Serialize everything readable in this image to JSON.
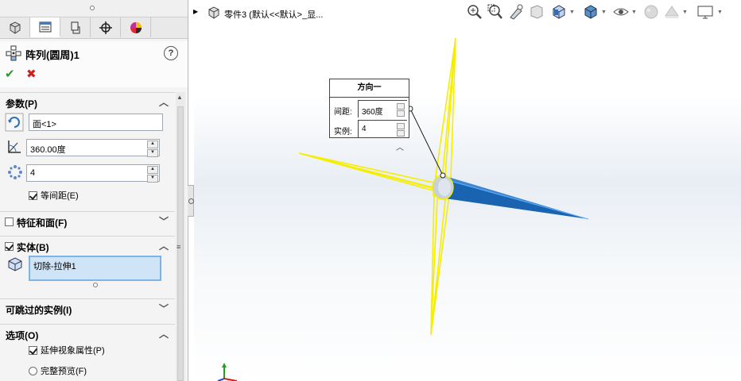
{
  "property_manager": {
    "feature_title": "阵列(圆周)1",
    "help_label": "?",
    "ok_glyph": "✔",
    "cancel_glyph": "✖",
    "tabs": [
      {
        "icon": "feature-manager-icon"
      },
      {
        "icon": "property-manager-icon"
      },
      {
        "icon": "configuration-manager-icon"
      },
      {
        "icon": "dimxpert-manager-icon"
      },
      {
        "icon": "display-manager-icon"
      }
    ],
    "parameters": {
      "header": "参数(P)",
      "axis_value": "面<1>",
      "angle_value": "360.00度",
      "instances_value": "4",
      "equal_spacing_label": "等间距(E)",
      "equal_spacing_checked": true
    },
    "features_faces": {
      "header": "特征和面(F)",
      "checked": false
    },
    "bodies": {
      "header": "实体(B)",
      "checked": true,
      "items": [
        "切除-拉伸1"
      ]
    },
    "skip_instances": {
      "header": "可跳过的实例(I)"
    },
    "options": {
      "header": "选项(O)",
      "propagate_visual_label": "延伸视象属性(P)",
      "propagate_visual_checked": true,
      "full_preview_label": "完整预览(F)"
    }
  },
  "graphics": {
    "tree_title": "零件3  (默认<<默认>_显...",
    "callout": {
      "title": "方向一",
      "spacing_label": "间距:",
      "spacing_value": "360度",
      "instances_label": "实例:",
      "instances_value": "4"
    },
    "colors": {
      "preview": "#f5ee00",
      "body": "#1a63b0",
      "accent": "#7fb4e2"
    }
  },
  "toolbar": {
    "icons": [
      "zoom-to-fit-icon",
      "zoom-area-icon",
      "previous-view-icon",
      "section-view-icon",
      "view-orientation-icon",
      "display-style-icon",
      "hide-show-icon",
      "edit-appearance-icon",
      "apply-scene-icon",
      "view-settings-icon"
    ]
  }
}
